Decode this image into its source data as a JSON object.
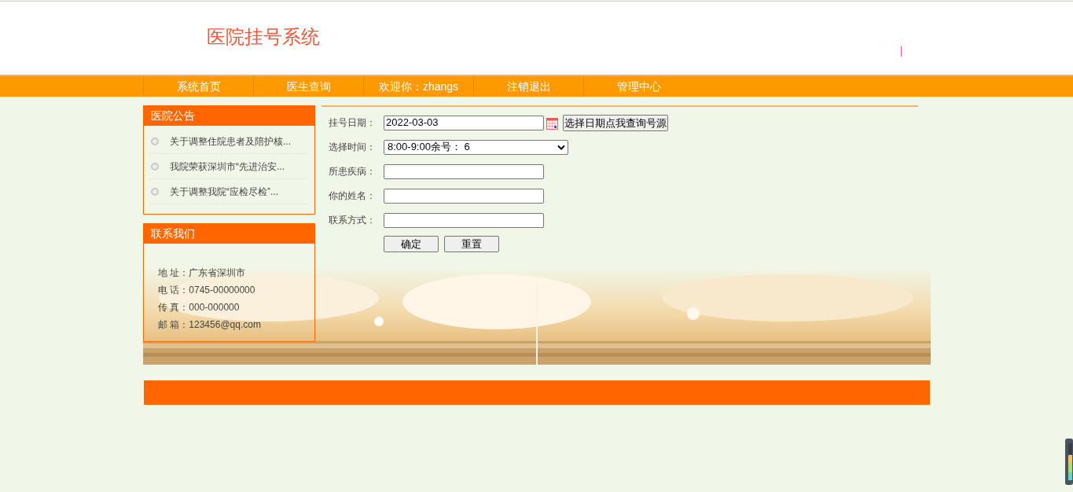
{
  "header": {
    "title": "医院挂号系统"
  },
  "nav": [
    "系统首页",
    "医生查询",
    "欢迎你：zhangs",
    "注销退出",
    "管理中心"
  ],
  "notices": {
    "title": "医院公告",
    "items": [
      "关于调整住院患者及陪护核...",
      "我院荣获深圳市“先进治安...",
      "关于调整我院“应检尽检”..."
    ]
  },
  "contact": {
    "title": "联系我们",
    "lines": [
      {
        "label": "地 址：",
        "value": "广东省深圳市"
      },
      {
        "label": "电 话：",
        "value": "0745-00000000"
      },
      {
        "label": "传 真：",
        "value": "000-000000"
      },
      {
        "label": "邮 箱：",
        "value": "123456@qq.com"
      }
    ]
  },
  "form": {
    "fields": [
      {
        "kind": "date",
        "label": "挂号日期：",
        "value": "2022-03-03",
        "button": "选择日期点我查询号源"
      },
      {
        "kind": "select",
        "label": "选择时间：",
        "value": "8:00-9:00余号： 6"
      },
      {
        "kind": "text",
        "label": "所患疾病："
      },
      {
        "kind": "text",
        "label": "你的姓名："
      },
      {
        "kind": "text",
        "label": "联系方式："
      }
    ],
    "buttons": [
      "确定",
      "重置"
    ]
  }
}
